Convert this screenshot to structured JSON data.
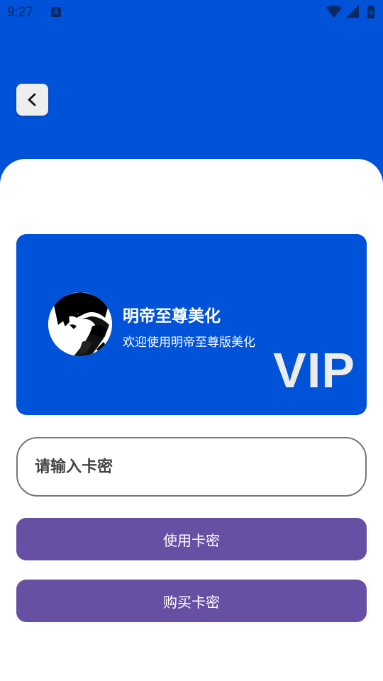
{
  "status_bar": {
    "time": "9:27",
    "icons": [
      "a-notification-icon",
      "wifi-icon",
      "signal-icon",
      "battery-icon"
    ]
  },
  "colors": {
    "primary_blue": "#0052D9",
    "button_purple": "#6750A4",
    "sheet_white": "#FFFFFF"
  },
  "header": {
    "back_icon": "chevron-left-icon"
  },
  "vip_card": {
    "title": "明帝至尊美化",
    "subtitle": "欢迎使用明帝至尊版美化",
    "badge": "VIP"
  },
  "card_key": {
    "placeholder": "请输入卡密",
    "value": ""
  },
  "actions": {
    "use_label": "使用卡密",
    "buy_label": "购买卡密"
  }
}
